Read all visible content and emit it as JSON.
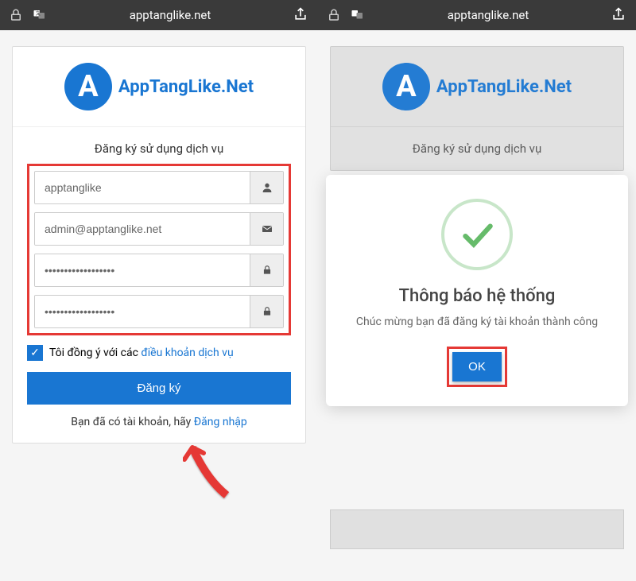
{
  "browser": {
    "url": "apptanglike.net"
  },
  "logo": {
    "letter": "A",
    "brand": "AppTangLike.Net"
  },
  "screen1": {
    "title": "Đăng ký sử dụng dịch vụ",
    "username": "apptanglike",
    "email": "admin@apptanglike.net",
    "password": "••••••••••••••••••",
    "confirm": "••••••••••••••••••",
    "agree_prefix": "Tôi đồng ý với các ",
    "terms_link": "điều khoản dịch vụ",
    "submit": "Đăng ký",
    "login_prefix": "Bạn đã có tài khoản, hãy ",
    "login_link": "Đăng nhập"
  },
  "screen2": {
    "title": "Đăng ký sử dụng dịch vụ",
    "modal_title": "Thông báo hệ thống",
    "modal_message": "Chúc mừng bạn đã đăng ký tài khoản thành công",
    "ok": "OK"
  }
}
